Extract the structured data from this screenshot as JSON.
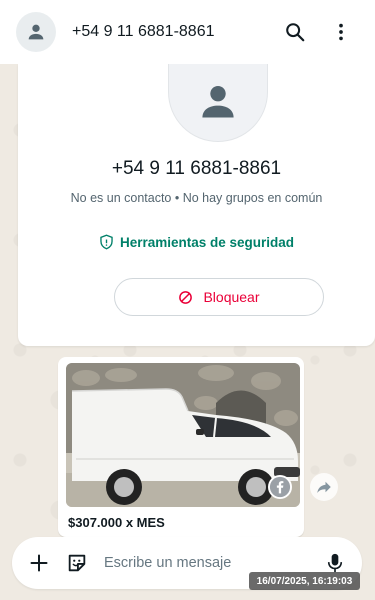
{
  "header": {
    "contact_name": "+54 9 11 6881-8861",
    "avatar_icon": "person-icon",
    "search_icon": "search-icon",
    "menu_icon": "more-vert-icon"
  },
  "contact_card": {
    "phone": "+54 9 11 6881-8861",
    "subtitle": "No es un contacto • No hay grupos en común",
    "safety_label": "Herramientas de seguridad",
    "block_label": "Bloquear"
  },
  "message": {
    "price_text": "$307.000 x MES",
    "image_subject": "white van",
    "badge_icon": "facebook-icon"
  },
  "composer": {
    "placeholder": "Escribe un mensaje",
    "add_icon": "plus-icon",
    "sticker_icon": "sticker-icon",
    "mic_icon": "mic-icon"
  },
  "overlay": {
    "timestamp": "16/07/2025, 16:19:03"
  },
  "colors": {
    "accent_green": "#008069",
    "danger_red": "#ea0038",
    "wallpaper": "#efeae2"
  }
}
